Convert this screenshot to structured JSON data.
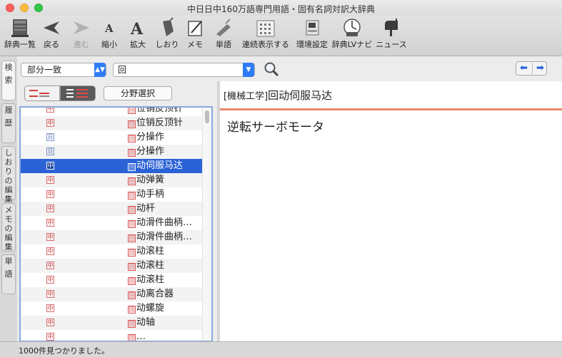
{
  "window": {
    "title": "中日日中160万語専門用語・固有名詞対訳大辞典"
  },
  "toolbar": [
    {
      "id": "dict-list",
      "label": "辞典一覧",
      "icon": "books-icon",
      "enabled": true
    },
    {
      "id": "back",
      "label": "戻る",
      "icon": "arrow-left-icon",
      "enabled": true
    },
    {
      "id": "forward",
      "label": "進む",
      "icon": "arrow-right-icon",
      "enabled": false
    },
    {
      "id": "shrink",
      "label": "縮小",
      "icon": "font-small-icon",
      "enabled": true
    },
    {
      "id": "enlarge",
      "label": "拡大",
      "icon": "font-large-icon",
      "enabled": true
    },
    {
      "id": "bookmark",
      "label": "しおり",
      "icon": "bookmark-icon",
      "enabled": true
    },
    {
      "id": "memo",
      "label": "メモ",
      "icon": "memo-icon",
      "enabled": true
    },
    {
      "id": "wordbook",
      "label": "単語",
      "icon": "wordbook-icon",
      "enabled": true
    },
    {
      "id": "continuous",
      "label": "連続表示する",
      "icon": "grid-icon",
      "enabled": true
    },
    {
      "id": "settings",
      "label": "環境設定",
      "icon": "settings-icon",
      "enabled": true
    },
    {
      "id": "lvnavi",
      "label": "辞典LVナビ",
      "icon": "lv-navi-icon",
      "enabled": true
    },
    {
      "id": "news",
      "label": "ニュース",
      "icon": "mailbox-icon",
      "enabled": true
    }
  ],
  "sidetabs": [
    "検索",
    "履歴",
    "しおりの編集",
    "メモの編集",
    "単語"
  ],
  "search": {
    "mode": "部分一致",
    "query": "回"
  },
  "filter": {
    "field_button": "分野選択"
  },
  "tag_glyphs": {
    "zh": "中",
    "ja": "日",
    "word_mark": "回"
  },
  "results": [
    {
      "lang": "zh",
      "word": "位销反顶针"
    },
    {
      "lang": "zh",
      "word": "位销反顶针"
    },
    {
      "lang": "ja",
      "word": "分操作"
    },
    {
      "lang": "ja",
      "word": "分操作"
    },
    {
      "lang": "zh",
      "word": "动伺服马达",
      "selected": true
    },
    {
      "lang": "zh",
      "word": "动弹簧"
    },
    {
      "lang": "zh",
      "word": "动手柄"
    },
    {
      "lang": "zh",
      "word": "动杆"
    },
    {
      "lang": "zh",
      "word": "动滑件曲柄…"
    },
    {
      "lang": "zh",
      "word": "动滑件曲柄…"
    },
    {
      "lang": "zh",
      "word": "动滚柱"
    },
    {
      "lang": "zh",
      "word": "动滚柱"
    },
    {
      "lang": "zh",
      "word": "动滚柱"
    },
    {
      "lang": "zh",
      "word": "动离合器"
    },
    {
      "lang": "zh",
      "word": "动螺旋"
    },
    {
      "lang": "zh",
      "word": "动轴"
    },
    {
      "lang": "zh",
      "word": "…"
    }
  ],
  "entry": {
    "field": "[機械工学]",
    "headword": "回动伺服马达",
    "meaning": "逆転サーボモータ"
  },
  "status": "1000件見つかりました。",
  "colors": {
    "accent": "#2e7cf6",
    "selection": "#2b62d6",
    "divider": "#e8886a"
  }
}
